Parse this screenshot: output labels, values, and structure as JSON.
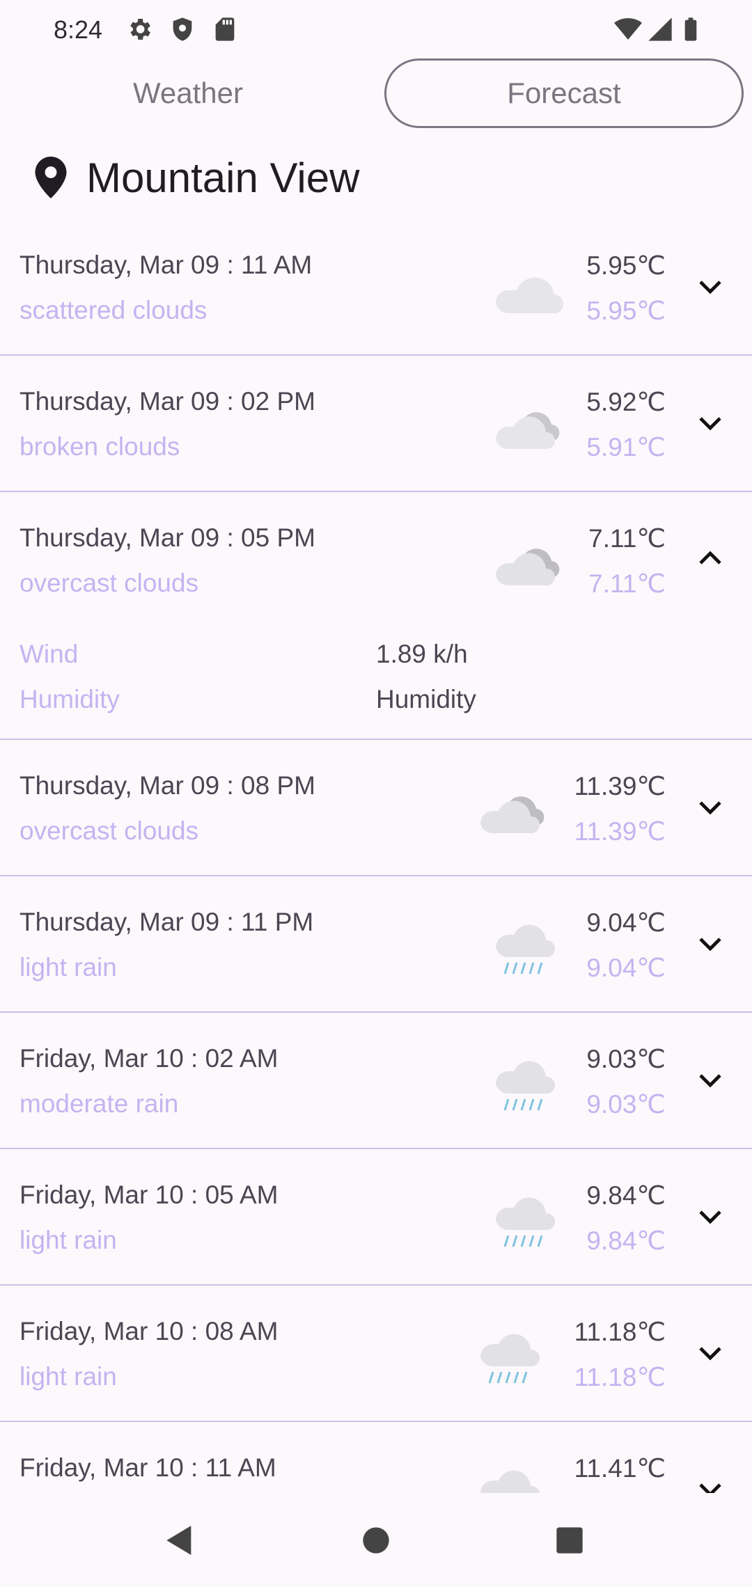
{
  "status_bar": {
    "time": "8:24",
    "icons": [
      "settings-icon",
      "shield-icon",
      "sd-card-icon",
      "wifi-icon",
      "signal-icon",
      "battery-icon"
    ]
  },
  "tabs": [
    {
      "label": "Weather",
      "selected": false
    },
    {
      "label": "Forecast",
      "selected": true
    }
  ],
  "location": {
    "icon": "location-pin-icon",
    "name": "Mountain View"
  },
  "forecast": [
    {
      "datetime": "Thursday, Mar 09 : 11 AM",
      "description": "scattered clouds",
      "temp": "5.95℃",
      "feels": "5.95℃",
      "icon": "scattered-clouds-icon",
      "expanded": false
    },
    {
      "datetime": "Thursday, Mar 09 : 02 PM",
      "description": "broken clouds",
      "temp": "5.92℃",
      "feels": "5.91℃",
      "icon": "broken-clouds-icon",
      "expanded": false
    },
    {
      "datetime": "Thursday, Mar 09 : 05 PM",
      "description": "overcast clouds",
      "temp": "7.11℃",
      "feels": "7.11℃",
      "icon": "overcast-clouds-icon",
      "expanded": true,
      "details": [
        {
          "label": "Wind",
          "value": "1.89 k/h"
        },
        {
          "label": "Humidity",
          "value": "Humidity"
        }
      ]
    },
    {
      "datetime": "Thursday, Mar 09 : 08 PM",
      "description": "overcast clouds",
      "temp": "11.39℃",
      "feels": "11.39℃",
      "icon": "overcast-clouds-icon",
      "expanded": false
    },
    {
      "datetime": "Thursday, Mar 09 : 11 PM",
      "description": "light rain",
      "temp": "9.04℃",
      "feels": "9.04℃",
      "icon": "rain-icon",
      "expanded": false
    },
    {
      "datetime": "Friday, Mar 10 : 02 AM",
      "description": "moderate rain",
      "temp": "9.03℃",
      "feels": "9.03℃",
      "icon": "rain-icon",
      "expanded": false
    },
    {
      "datetime": "Friday, Mar 10 : 05 AM",
      "description": "light rain",
      "temp": "9.84℃",
      "feels": "9.84℃",
      "icon": "rain-icon",
      "expanded": false
    },
    {
      "datetime": "Friday, Mar 10 : 08 AM",
      "description": "light rain",
      "temp": "11.18℃",
      "feels": "11.18℃",
      "icon": "rain-icon",
      "expanded": false
    },
    {
      "datetime": "Friday, Mar 10 : 11 AM",
      "description": "",
      "temp": "11.41℃",
      "feels": "",
      "icon": "rain-icon",
      "expanded": false
    }
  ],
  "nav_bar": {
    "icons": [
      "back-icon",
      "home-icon",
      "recents-icon"
    ]
  },
  "colors": {
    "background": "#FDF8FC",
    "accent_text": "#C4B4F0",
    "divider": "#CDBFE8"
  }
}
